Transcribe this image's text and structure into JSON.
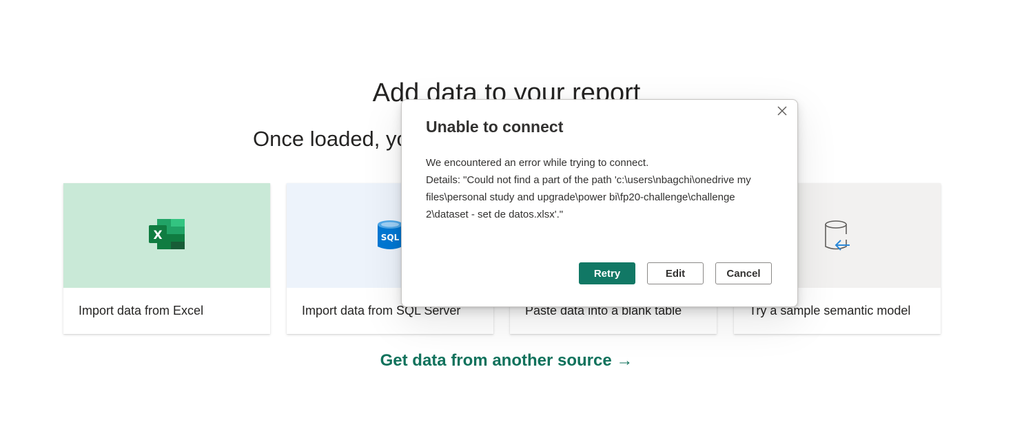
{
  "hero": {
    "title": "Add data to your report",
    "subtitle": "Once loaded, yo"
  },
  "cards": [
    {
      "label": "Import data from Excel",
      "icon": "excel-icon"
    },
    {
      "label": "Import data from SQL Server",
      "icon": "sql-server-icon"
    },
    {
      "label": "Paste data into a blank table",
      "icon": "blank-table-icon"
    },
    {
      "label": "Try a sample semantic model",
      "icon": "sample-model-icon"
    }
  ],
  "get_data_link": "Get data from another source →",
  "dialog": {
    "title": "Unable to connect",
    "message": "We encountered an error while trying to connect.",
    "details": "Details: \"Could not find a part of the path 'c:\\users\\nbagchi\\onedrive my files\\personal study and upgrade\\power bi\\fp20-challenge\\challenge 2\\dataset - set de datos.xlsx'.\"",
    "buttons": {
      "retry": "Retry",
      "edit": "Edit",
      "cancel": "Cancel"
    }
  },
  "colors": {
    "accent": "#117865",
    "excel_card_bg": "#c9e9d7",
    "sql_card_bg": "#edf3fb",
    "link": "#11725c"
  }
}
